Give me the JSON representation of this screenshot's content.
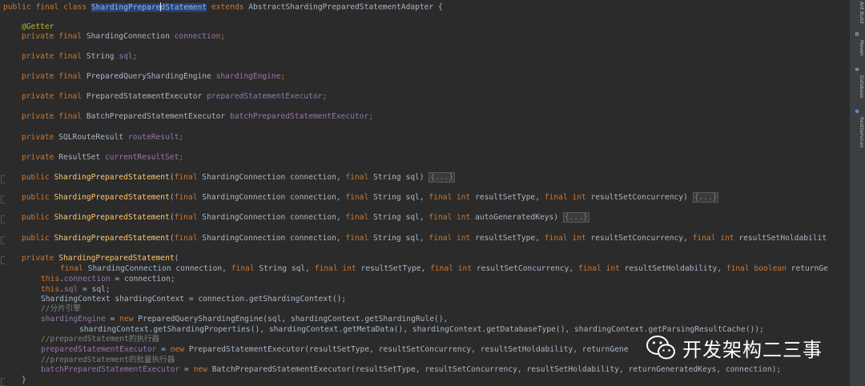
{
  "editor": {
    "decl": {
      "kw_public": "public",
      "kw_final": "final",
      "kw_class": "class",
      "class_name_a": "ShardingPrepare",
      "class_name_b": "dStatement",
      "kw_extends": "extends",
      "parent": "AbstractShardingPreparedStatementAdapter {"
    },
    "fields": {
      "getter": "@Getter",
      "conn_mod": "private final",
      "conn_type": "ShardingConnection",
      "conn_name": "connection",
      "sql_mod": "private final",
      "sql_type": "String",
      "sql_name": "sql",
      "engine_mod": "private final",
      "engine_type": "PreparedQueryShardingEngine",
      "engine_name": "shardingEngine",
      "pse_mod": "private final",
      "pse_type": "PreparedStatementExecutor",
      "pse_name": "preparedStatementExecutor",
      "bpse_mod": "private final",
      "bpse_type": "BatchPreparedStatementExecutor",
      "bpse_name": "batchPreparedStatementExecutor",
      "rr_mod": "private",
      "rr_type": "SQLRouteResult",
      "rr_name": "routeResult",
      "crs_mod": "private",
      "crs_type": "ResultSet",
      "crs_name": "currentResultSet"
    },
    "ctors": {
      "c1_pub": "public",
      "c1_name": "ShardingPreparedStatement",
      "c1_p1": "(",
      "c1_final1": "final",
      "c1_p2": " ShardingConnection connection, ",
      "c1_final2": "final",
      "c1_p3": " String sql) ",
      "c1_fold": "{...}",
      "c2_pub": "public",
      "c2_name": "ShardingPreparedStatement",
      "c2_a": "(",
      "c2_f1": "final",
      "c2_b": " ShardingConnection connection, ",
      "c2_f2": "final",
      "c2_c": " String sql, ",
      "c2_f3": "final int",
      "c2_d": " resultSetType, ",
      "c2_f4": "final int",
      "c2_e": " resultSetConcurrency) ",
      "c2_fold": "{...}",
      "c3_pub": "public",
      "c3_name": "ShardingPreparedStatement",
      "c3_a": "(",
      "c3_f1": "final",
      "c3_b": " ShardingConnection connection, ",
      "c3_f2": "final",
      "c3_c": " String sql, ",
      "c3_f3": "final int",
      "c3_d": " autoGeneratedKeys) ",
      "c3_fold": "{...}",
      "c4_pub": "public",
      "c4_name": "ShardingPreparedStatement",
      "c4_a": "(",
      "c4_f1": "final",
      "c4_b": " ShardingConnection connection, ",
      "c4_f2": "final",
      "c4_c": " String sql, ",
      "c4_f3": "final int",
      "c4_d": " resultSetType, ",
      "c4_f4": "final int",
      "c4_e": " resultSetConcurrency, ",
      "c4_f5": "final int",
      "c4_g": " resultSetHoldabilit"
    },
    "priv_ctor": {
      "mod": "private",
      "name": "ShardingPreparedStatement",
      "paren": "(",
      "p_f1": "final",
      "p_a": " ShardingConnection connection, ",
      "p_f2": "final",
      "p_b": " String sql, ",
      "p_f3": "final int",
      "p_c": " resultSetType, ",
      "p_f4": "final int",
      "p_d": " resultSetConcurrency, ",
      "p_f5": "final int",
      "p_e": " resultSetHoldability, ",
      "p_f6": "final boolean",
      "p_g": " returnGe",
      "this1": "this",
      "this1_dot": ".",
      "this1_fld": "connection",
      "this1_rest": " = connection;",
      "this2": "this",
      "this2_dot": ".",
      "this2_fld": "sql",
      "this2_rest": " = sql;",
      "ctx_line": "ShardingContext shardingContext = connection.getShardingContext();",
      "cmt1": "//分片引擎",
      "eng_fld": "shardingEngine",
      "eng_eq": " = ",
      "eng_new": "new",
      "eng_rest": " PreparedQueryShardingEngine(sql, shardingContext.getShardingRule(),",
      "eng_cont": "shardingContext.getShardingProperties(), shardingContext.getMetaData(), shardingContext.getDatabaseType(), shardingContext.getParsingResultCache());",
      "cmt2": "//preparedStatement的执行器",
      "pse_fld": "preparedStatementExecutor",
      "pse_eq": " = ",
      "pse_new": "new",
      "pse_rest": " PreparedStatementExecutor(resultSetType, resultSetConcurrency, resultSetHoldability, returnGene",
      "cmt3": "//preparedStatement的批量执行器",
      "bpse_fld": "batchPreparedStatementExecutor",
      "bpse_eq": " = ",
      "bpse_new": "new",
      "bpse_rest": " BatchPreparedStatementExecutor(resultSetType, resultSetConcurrency, resultSetHoldability, returnGeneratedKeys, connection);",
      "close": "}"
    }
  },
  "right_bar": {
    "tab1": "Ant Build",
    "tab2": "Maven",
    "tab3": "Database",
    "tab4": "RestServices"
  },
  "watermark": {
    "text": "开发架构二三事"
  },
  "colors": {
    "background": "#2b2b2b",
    "keyword": "#cc7832",
    "field": "#9876aa",
    "method": "#ffc66d",
    "comment": "#808080",
    "annotation": "#bbb529",
    "default_text": "#a9b7c6",
    "selection": "#214283"
  }
}
